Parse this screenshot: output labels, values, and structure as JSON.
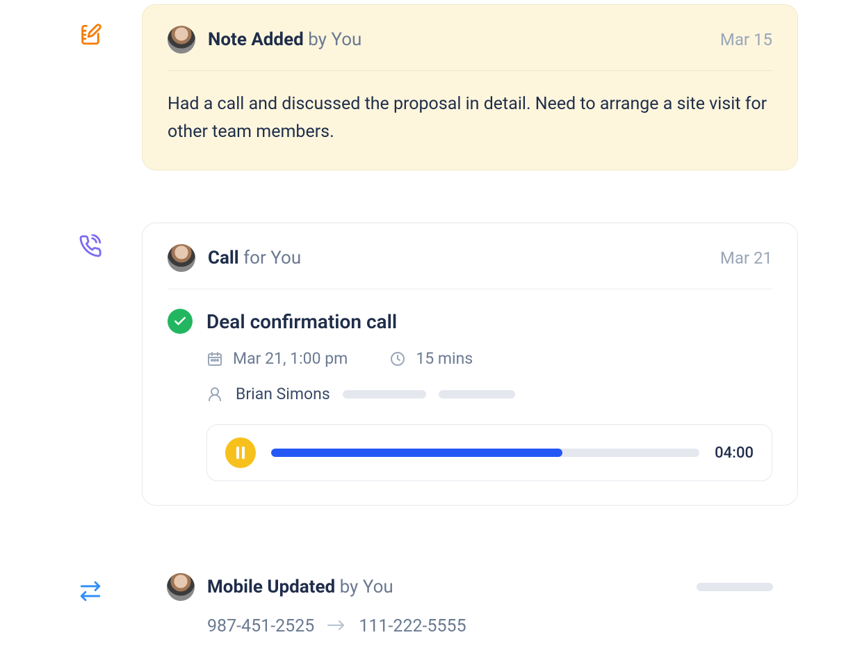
{
  "timeline": {
    "items": [
      {
        "kind": "note",
        "title_bold": "Note Added",
        "title_light": " by You",
        "date": "Mar 15",
        "body": "Had a call and discussed the proposal in detail. Need to arrange a site visit for other team members."
      },
      {
        "kind": "call",
        "title_bold": "Call",
        "title_light": " for You",
        "date": "Mar 21",
        "call_title": "Deal confirmation call",
        "datetime": "Mar 21, 1:00 pm",
        "duration": "15 mins",
        "person": "Brian Simons",
        "audio_time": "04:00",
        "audio_progress_pct": 68
      },
      {
        "kind": "update",
        "title_bold": "Mobile Updated",
        "title_light": " by You",
        "old_value": "987-451-2525",
        "new_value": "111-222-5555"
      }
    ]
  }
}
